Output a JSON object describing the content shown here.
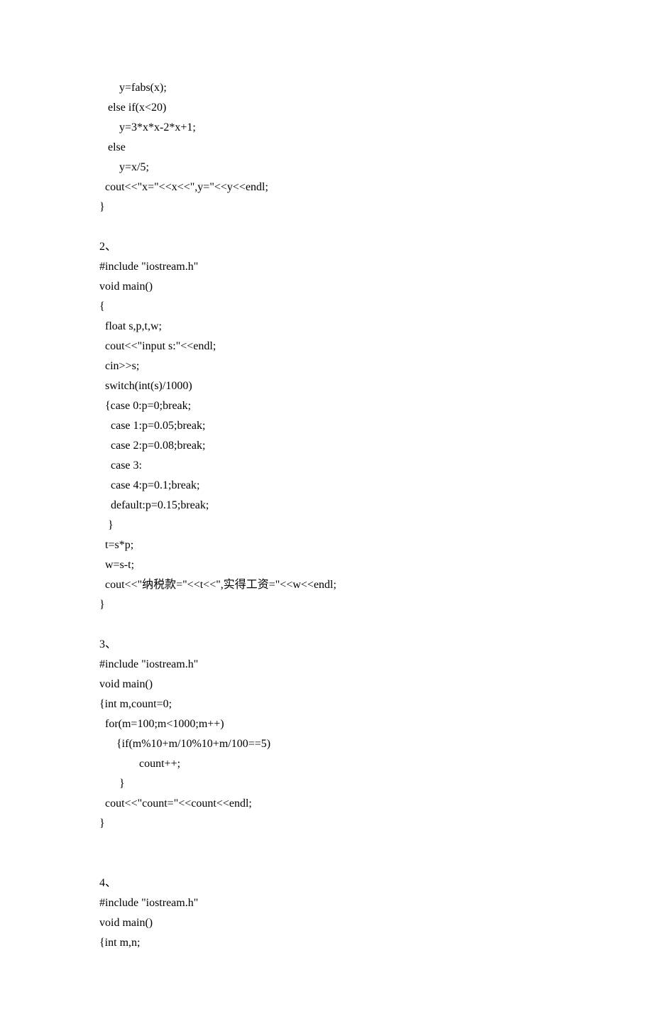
{
  "block1": {
    "lines": [
      "       y=fabs(x);",
      "   else if(x<20)",
      "       y=3*x*x-2*x+1;",
      "   else",
      "       y=x/5;",
      "  cout<<\"x=\"<<x<<\",y=\"<<y<<endl;",
      "}"
    ]
  },
  "block2": {
    "header": "2、",
    "lines": [
      "#include \"iostream.h\"",
      "void main()",
      "{",
      "  float s,p,t,w;",
      "  cout<<\"input s:\"<<endl;",
      "  cin>>s;",
      "  switch(int(s)/1000)",
      "  {case 0:p=0;break;",
      "    case 1:p=0.05;break;",
      "    case 2:p=0.08;break;",
      "    case 3:",
      "    case 4:p=0.1;break;",
      "    default:p=0.15;break;",
      "   }",
      "  t=s*p;",
      "  w=s-t;",
      "  cout<<\"纳税款=\"<<t<<\",实得工资=\"<<w<<endl;",
      "}"
    ]
  },
  "block3": {
    "header": "3、",
    "lines": [
      "#include \"iostream.h\"",
      "void main()",
      "{int m,count=0;",
      "  for(m=100;m<1000;m++)",
      "      {if(m%10+m/10%10+m/100==5)",
      "              count++;",
      "       }",
      "  cout<<\"count=\"<<count<<endl;",
      "}"
    ]
  },
  "block4": {
    "header": "4、",
    "lines": [
      "#include \"iostream.h\"",
      "void main()",
      "{int m,n;"
    ]
  }
}
